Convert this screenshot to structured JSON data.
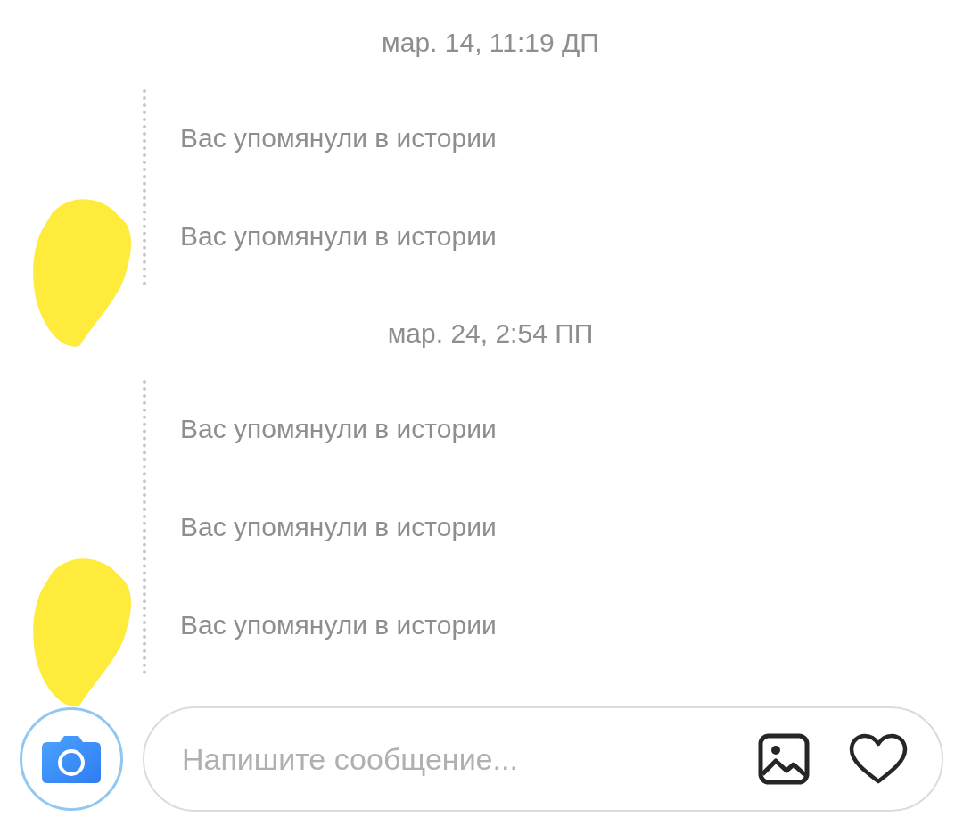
{
  "conversation": [
    {
      "date": "мар. 14, 11:19 ДП",
      "messages": [
        "Вас упомянули в истории",
        "Вас упомянули в истории"
      ]
    },
    {
      "date": "мар. 24, 2:54 ПП",
      "messages": [
        "Вас упомянули в истории",
        "Вас упомянули в истории",
        "Вас упомянули в истории"
      ]
    }
  ],
  "composer": {
    "placeholder": "Напишите сообщение..."
  }
}
